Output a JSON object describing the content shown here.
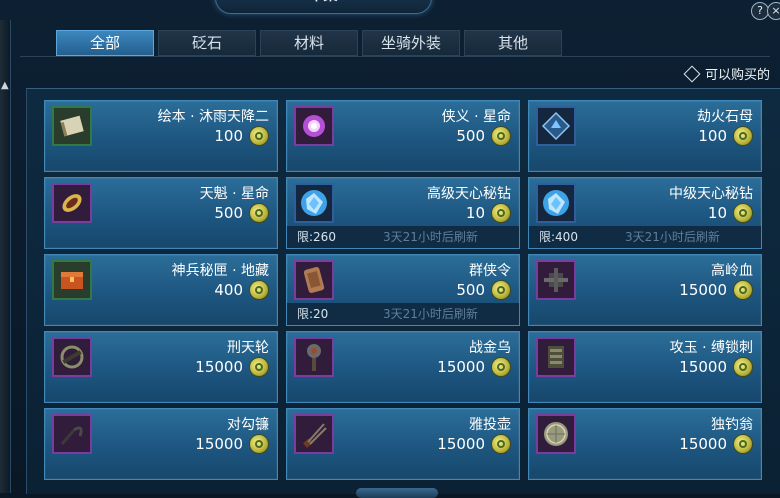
{
  "window": {
    "title": "市集",
    "help_label": "?",
    "close_label": "×"
  },
  "tabs": [
    {
      "label": "全部",
      "active": true
    },
    {
      "label": "砭石",
      "active": false
    },
    {
      "label": "材料",
      "active": false
    },
    {
      "label": "坐骑外装",
      "active": false
    },
    {
      "label": "其他",
      "active": false
    }
  ],
  "filter": {
    "label": "可以购买的",
    "checked": false
  },
  "currency_icon": "coin-icon",
  "items": [
    {
      "name": "绘本 · 沐雨天降二",
      "price": "100",
      "icon": "scroll-icon",
      "rarity": "green"
    },
    {
      "name": "侠义 · 星命",
      "price": "500",
      "icon": "purple-orb-icon",
      "rarity": "purple"
    },
    {
      "name": "劫火石母",
      "price": "100",
      "icon": "blue-crystal-icon",
      "rarity": "blue"
    },
    {
      "name": "天魁 · 星命",
      "price": "500",
      "icon": "golden-bracer-icon",
      "rarity": "purple"
    },
    {
      "name": "高级天心秘钻",
      "price": "10",
      "icon": "blue-gem-icon",
      "rarity": "blue",
      "limit": "限:260",
      "refresh": "3天21小时后刷新"
    },
    {
      "name": "中级天心秘钻",
      "price": "10",
      "icon": "blue-gem-icon",
      "rarity": "blue",
      "limit": "限:400",
      "refresh": "3天21小时后刷新"
    },
    {
      "name": "神兵秘匣 · 地藏",
      "price": "400",
      "icon": "red-box-icon",
      "rarity": "green"
    },
    {
      "name": "群侠令",
      "price": "500",
      "icon": "token-icon",
      "rarity": "purple",
      "limit": "限:20",
      "refresh": "3天21小时后刷新"
    },
    {
      "name": "高岭血",
      "price": "15000",
      "icon": "dark-weapon-icon",
      "rarity": "purple"
    },
    {
      "name": "刑天轮",
      "price": "15000",
      "icon": "wheel-weapon-icon",
      "rarity": "purple"
    },
    {
      "name": "战金乌",
      "price": "15000",
      "icon": "mace-icon",
      "rarity": "purple"
    },
    {
      "name": "攻玉 · 缚锁刺",
      "price": "15000",
      "icon": "gauntlet-icon",
      "rarity": "purple"
    },
    {
      "name": "对勾镰",
      "price": "15000",
      "icon": "sickle-icon",
      "rarity": "purple"
    },
    {
      "name": "雅投壶",
      "price": "15000",
      "icon": "arrows-icon",
      "rarity": "purple"
    },
    {
      "name": "独钓翁",
      "price": "15000",
      "icon": "shield-icon",
      "rarity": "purple"
    }
  ]
}
